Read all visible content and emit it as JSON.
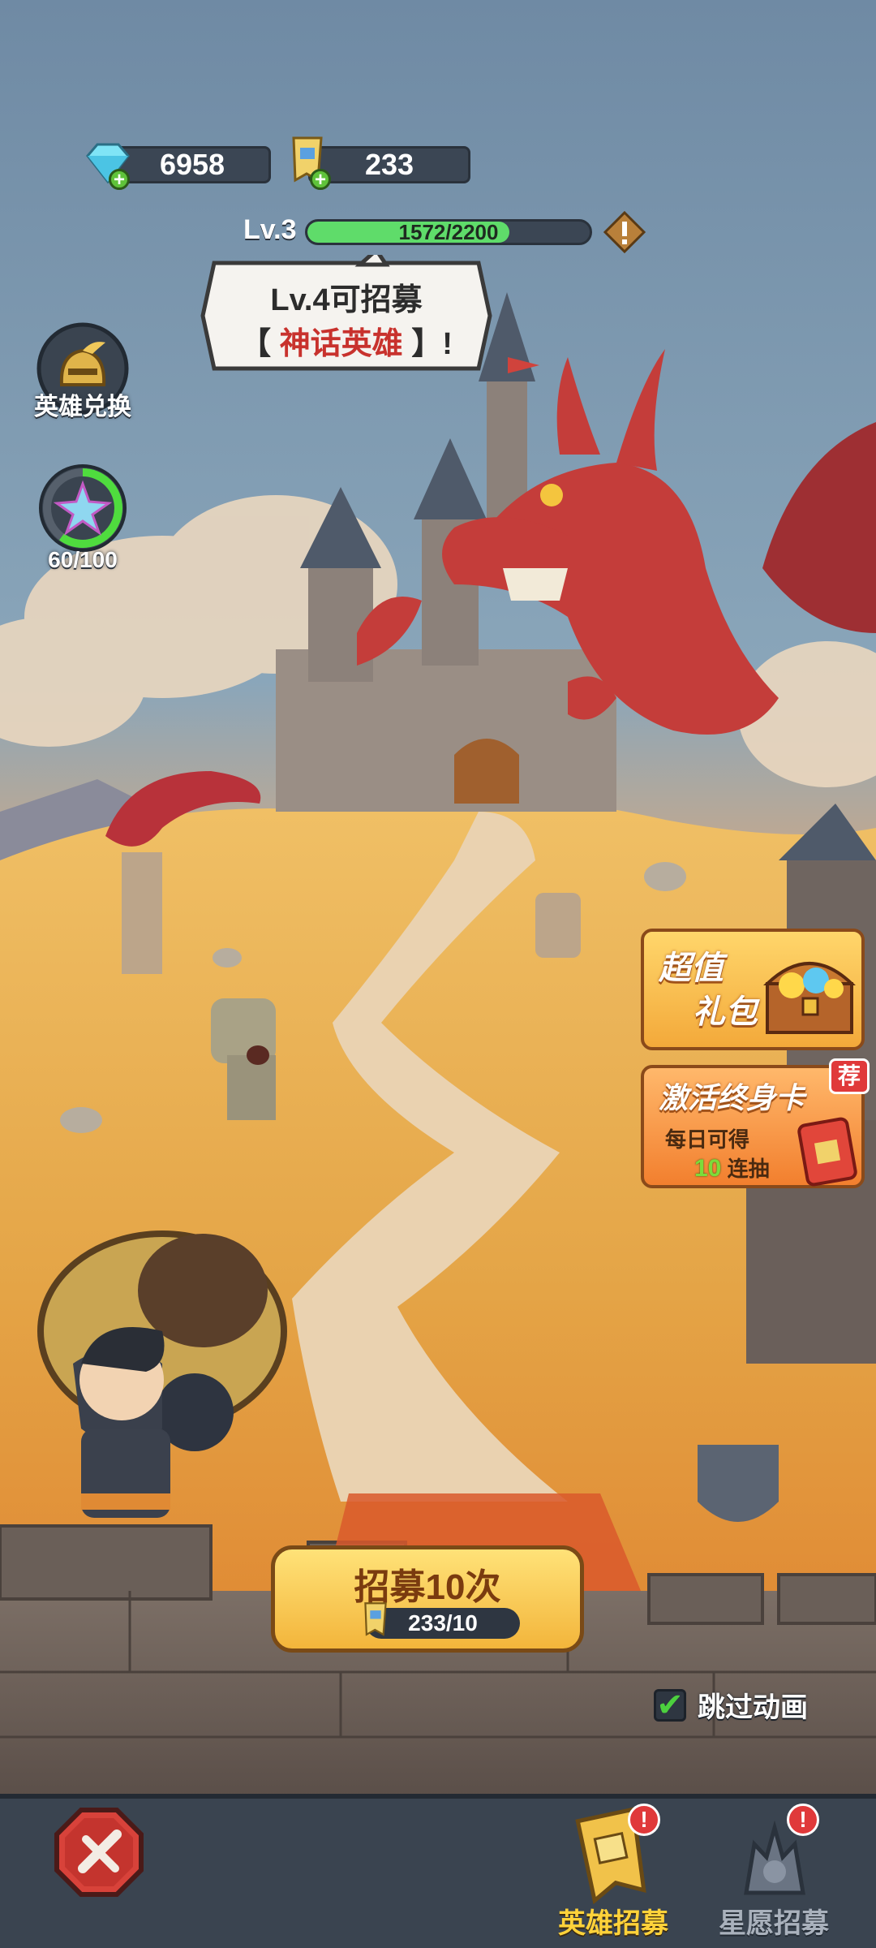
{
  "currency": {
    "gems": "6958",
    "tickets": "233"
  },
  "level": {
    "label": "Lv.3",
    "xp_text": "1572/2200",
    "xp_progress": 0.7145
  },
  "bubble": {
    "line1": "Lv.4可招募",
    "open_bracket": "【",
    "highlight": "神话英雄",
    "close": "】!"
  },
  "side": {
    "exchange_label": "英雄兑换",
    "star_progress_text": "60/100",
    "star_progress": 0.6
  },
  "promos": {
    "gift_line1": "超值",
    "gift_line2": "礼包",
    "card_title": "激活终身卡",
    "card_line1": "每日可得",
    "card_count": "10",
    "card_line2": "连抽",
    "card_badge": "荐"
  },
  "recruit": {
    "title": "招募10次",
    "cost": "233/10"
  },
  "skip": {
    "label": "跳过动画",
    "checked": true
  },
  "nav": {
    "hero_recruit": "英雄招募",
    "star_recruit": "星愿招募",
    "alert_mark": "!"
  },
  "colors": {
    "accent_gold": "#f3b53b",
    "xp_green": "#5fdc6a",
    "alert_red": "#e0393a",
    "dragon_red": "#c43d3a"
  },
  "icons": [
    "gem-icon",
    "ticket-icon",
    "info-icon",
    "hero-helmet-icon",
    "star-crystal-icon",
    "treasure-chest-icon",
    "close-swords-icon",
    "hero-recruit-icon",
    "star-recruit-icon",
    "checkmark-icon"
  ]
}
